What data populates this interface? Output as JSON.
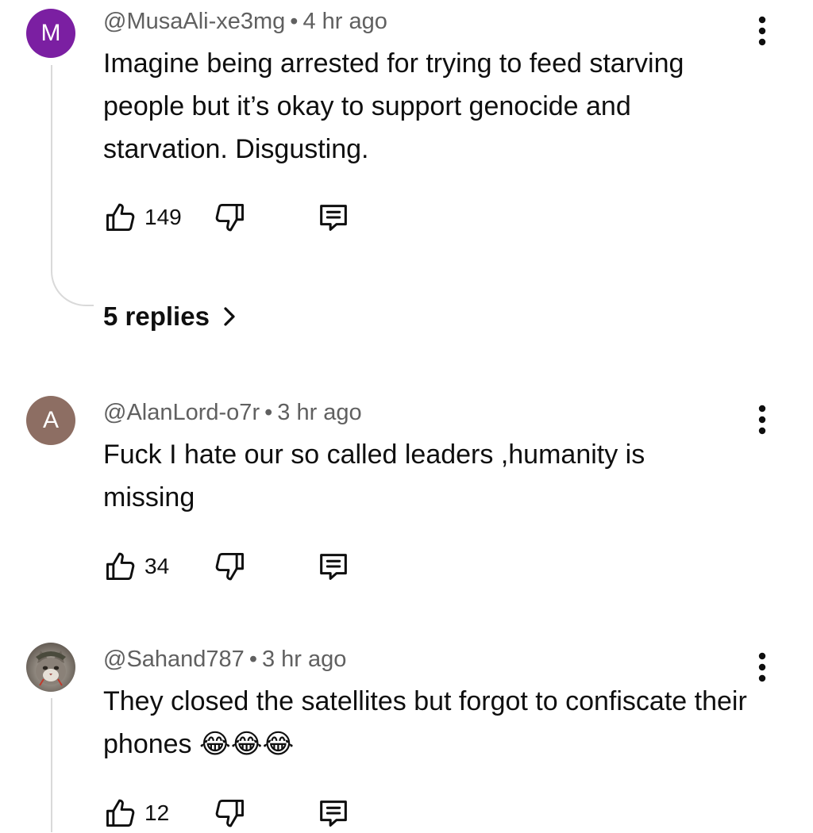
{
  "comments": [
    {
      "handle": "@MusaAli-xe3mg",
      "separator": "•",
      "time": "4 hr ago",
      "avatar_letter": "M",
      "avatar_color": "#7b1fa2",
      "text": "Imagine being arrested for trying to feed starving people but it’s okay to support genocide and starvation. Disgusting.",
      "likes": "149",
      "replies_label": "5 replies"
    },
    {
      "handle": "@AlanLord-o7r",
      "separator": "•",
      "time": "3 hr ago",
      "avatar_letter": "A",
      "avatar_color": "#8d6e63",
      "text": "Fuck I hate our so called leaders ,humanity is missing",
      "likes": "34"
    },
    {
      "handle": "@Sahand787",
      "separator": "•",
      "time": "3 hr ago",
      "avatar_icon": "cat-photo-avatar",
      "text": "They closed the satellites but forgot to confiscate their phones",
      "emoji": "😂😂😂",
      "likes": "12"
    }
  ],
  "icons": {
    "like": "thumbs-up-icon",
    "dislike": "thumbs-down-icon",
    "reply": "comment-reply-icon",
    "more": "more-vert-icon",
    "chevron": "chevron-right-icon"
  }
}
